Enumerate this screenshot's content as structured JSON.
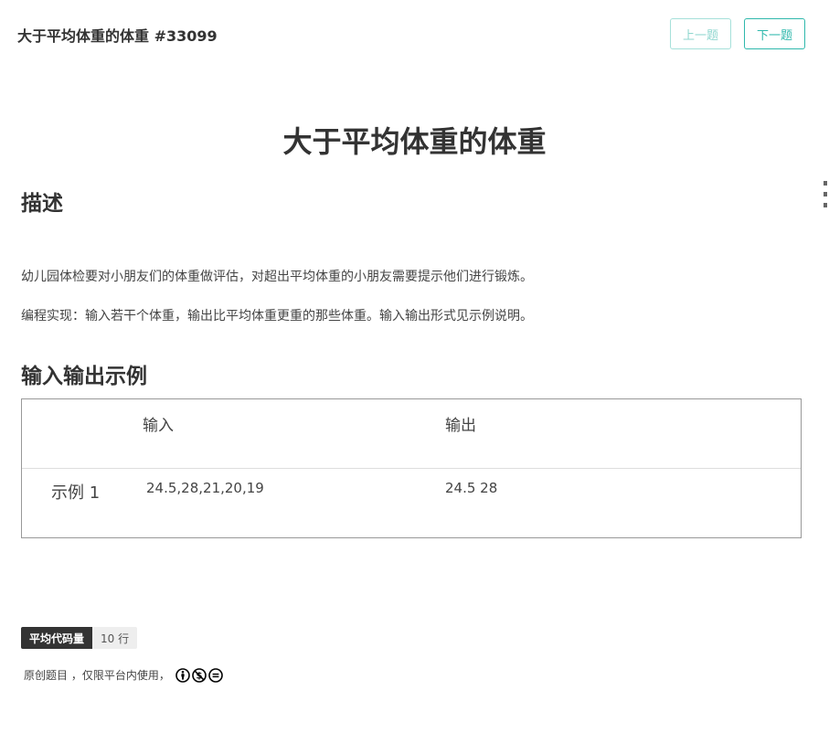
{
  "header": {
    "title": "大于平均体重的体重 #33099",
    "prev_label": "上一题",
    "next_label": "下一题"
  },
  "problem": {
    "title": "大于平均体重的体重"
  },
  "description": {
    "heading": "描述",
    "paragraphs": [
      "幼儿园体检要对小朋友们的体重做评估，对超出平均体重的小朋友需要提示他们进行锻炼。",
      "编程实现：输入若干个体重，输出比平均体重更重的那些体重。输入输出形式见示例说明。"
    ]
  },
  "examples": {
    "heading": "输入输出示例",
    "columns": [
      "输入",
      "输出"
    ],
    "rows": [
      {
        "label": "示例 1",
        "input": "24.5,28,21,20,19",
        "output": "24.5 28"
      }
    ]
  },
  "stats": {
    "label": "平均代码量",
    "value": "10 行"
  },
  "license": {
    "text": "原创题目 ，仅限平台内使用，",
    "icons": [
      "cc-by-icon",
      "cc-nc-icon",
      "cc-nd-icon"
    ]
  },
  "colors": {
    "accent": "#2fb8ac",
    "text": "#333333"
  }
}
